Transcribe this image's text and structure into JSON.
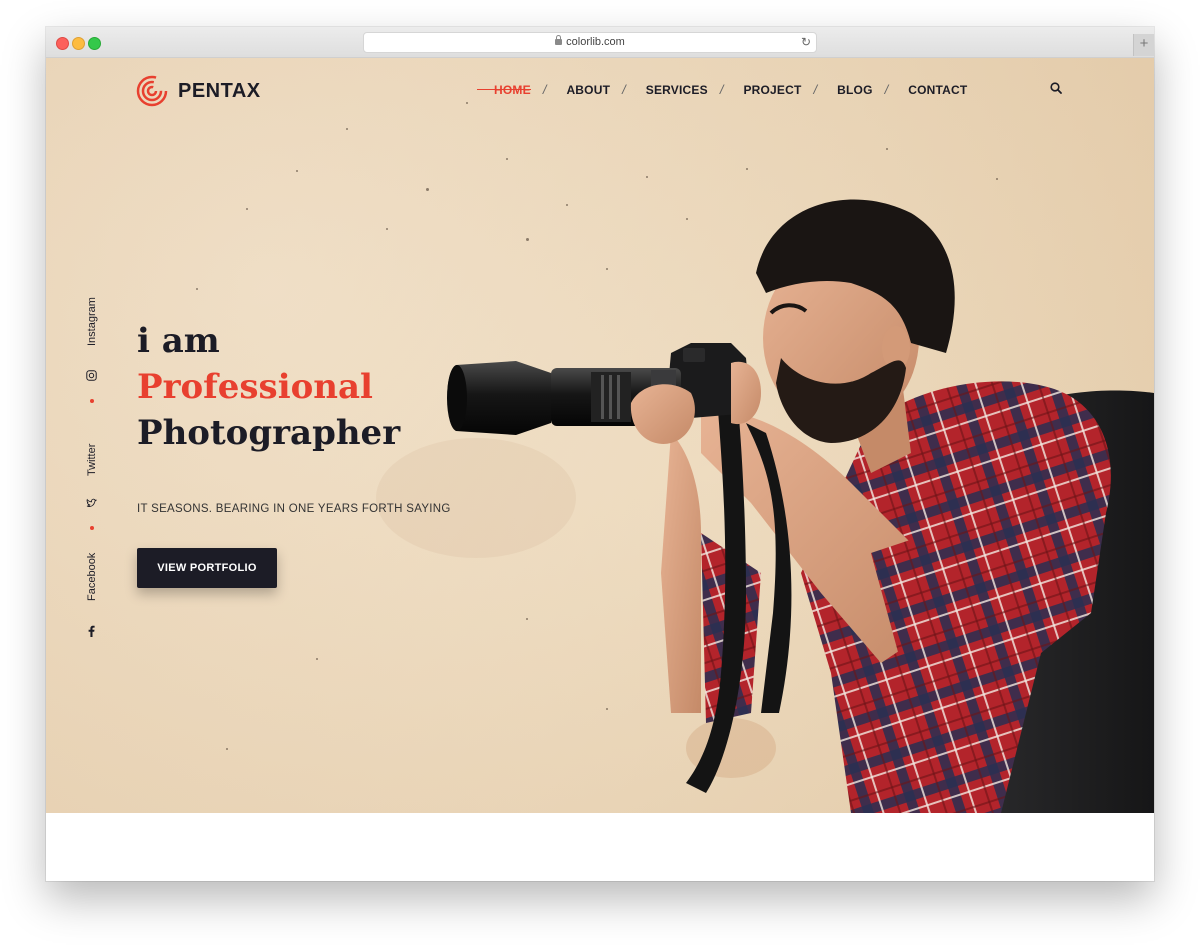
{
  "browser": {
    "url": "colorlib.com",
    "new_tab_label": "+"
  },
  "brand": {
    "name": "PENTAX",
    "accent_color": "#e8402f",
    "dark_color": "#1c1c26"
  },
  "nav": {
    "items": [
      {
        "label": "HOME",
        "active": true
      },
      {
        "label": "ABOUT"
      },
      {
        "label": "SERVICES"
      },
      {
        "label": "PROJECT"
      },
      {
        "label": "BLOG"
      },
      {
        "label": "CONTACT"
      }
    ],
    "separator": "/"
  },
  "social": {
    "items": [
      {
        "label": "Instagram",
        "icon": "instagram-icon"
      },
      {
        "label": "Twitter",
        "icon": "twitter-icon"
      },
      {
        "label": "Facebook",
        "icon": "facebook-icon"
      }
    ]
  },
  "hero": {
    "line1": "i am",
    "line2": "Professional",
    "line3": "Photographer",
    "tagline": "IT SEASONS. BEARING IN ONE YEARS FORTH SAYING",
    "cta_label": "VIEW PORTFOLIO"
  }
}
